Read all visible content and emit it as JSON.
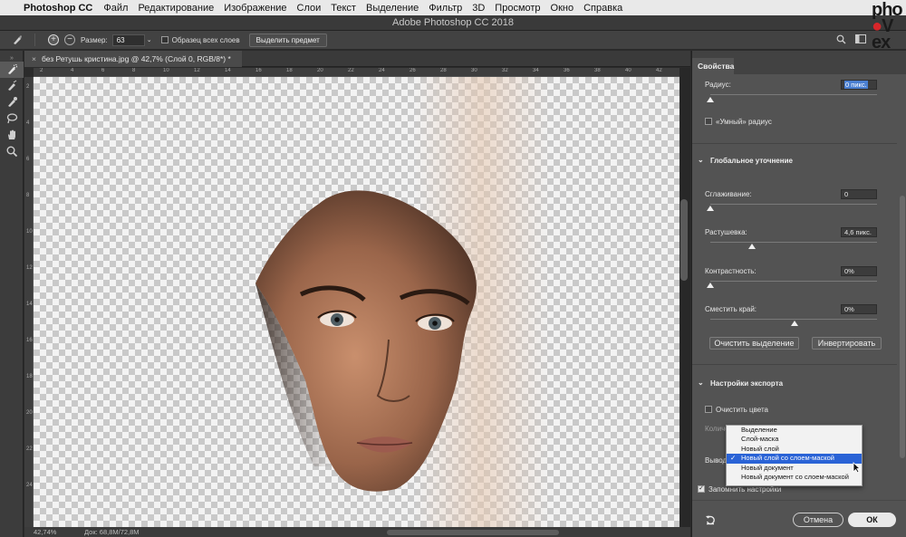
{
  "menubar": {
    "app_name": "Photoshop CC",
    "items": [
      "Файл",
      "Редактирование",
      "Изображение",
      "Слои",
      "Текст",
      "Выделение",
      "Фильтр",
      "3D",
      "Просмотр",
      "Окно",
      "Справка"
    ]
  },
  "window": {
    "title": "Adobe Photoshop CC 2018"
  },
  "options": {
    "size_label": "Размер:",
    "size_value": "63",
    "sample_all_label": "Образец всех слоев",
    "select_subject_label": "Выделить предмет"
  },
  "document": {
    "tab_title": "без Ретушь кристина.jpg @ 42,7% (Слой 0, RGB/8*) *",
    "zoom": "42,74%",
    "doc_info": "Док: 68,8M/72,8M"
  },
  "ruler": {
    "h_ticks": [
      "2",
      "4",
      "6",
      "8",
      "10",
      "12",
      "14",
      "16",
      "18",
      "20",
      "22",
      "24",
      "26",
      "28",
      "30",
      "32",
      "34",
      "36",
      "38",
      "40",
      "42"
    ],
    "v_ticks": [
      "2",
      "4",
      "6",
      "8",
      "10",
      "12",
      "14",
      "16",
      "18",
      "20",
      "22",
      "24"
    ]
  },
  "panel": {
    "tab": "Свойства",
    "radius_label": "Радиус:",
    "radius_value": "0 пикс.",
    "smart_radius_label": "«Умный» радиус",
    "global_section": "Глобальное уточнение",
    "smooth_label": "Сглаживание:",
    "smooth_value": "0",
    "feather_label": "Растушевка:",
    "feather_value": "4,6 пикс.",
    "contrast_label": "Контрастность:",
    "contrast_value": "0%",
    "shift_label": "Сместить край:",
    "shift_value": "0%",
    "clear_selection_button": "Очистить выделение",
    "invert_button": "Инвертировать",
    "export_section": "Настройки экспорта",
    "decontaminate_label": "Очистить цвета",
    "amount_label": "Количе",
    "output_label": "Вывод",
    "remember_label": "Запомнить настройки",
    "cancel_button": "Отмена",
    "ok_button": "ОК"
  },
  "dropdown": {
    "options": [
      "Выделение",
      "Слой-маска",
      "Новый слой",
      "Новый слой со слоем-маской",
      "Новый документ",
      "Новый документ со слоем-маской"
    ],
    "selected_index": 3
  }
}
